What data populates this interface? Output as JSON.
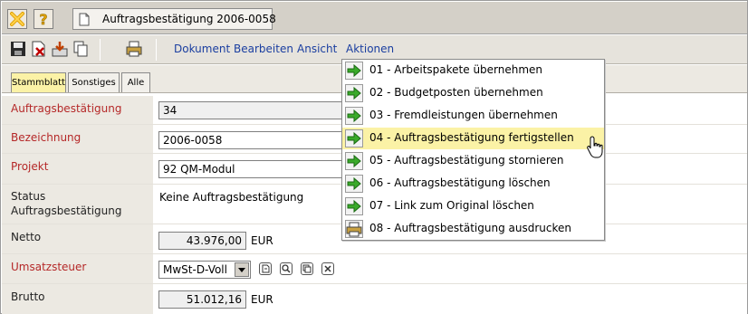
{
  "titlebar": {
    "title": "Auftragsbestätigung 2006-0058",
    "close_icon": "close-x-icon",
    "help_icon": "help-icon",
    "doc_icon": "document-icon"
  },
  "toolbar": {
    "icons": [
      "save-icon",
      "delete-icon",
      "export-icon",
      "copy-icon",
      "print-icon"
    ],
    "menu": {
      "dokument": "Dokument",
      "bearbeiten": "Bearbeiten",
      "ansicht": "Ansicht",
      "aktionen": "Aktionen"
    }
  },
  "tabs": [
    {
      "label": "Stammblatt",
      "active": true
    },
    {
      "label": "Sonstiges",
      "active": false
    },
    {
      "label": "Alle",
      "active": false
    }
  ],
  "form": {
    "auftragsbestaetigung": {
      "label": "Auftragsbestätigung",
      "value": "34"
    },
    "bezeichnung": {
      "label": "Bezeichnung",
      "value": "2006-0058"
    },
    "projekt": {
      "label": "Projekt",
      "value": "92 QM-Modul"
    },
    "status": {
      "label_line1": "Status",
      "label_line2": "Auftragsbestätigung",
      "value": "Keine Auftragsbestätigung"
    },
    "netto": {
      "label": "Netto",
      "value": "43.976,00",
      "unit": "EUR"
    },
    "umsatzsteuer": {
      "label": "Umsatzsteuer",
      "value": "MwSt-D-Voll",
      "action_icons": [
        "edit-icon",
        "search-icon",
        "copy-icon",
        "clear-icon"
      ]
    },
    "brutto": {
      "label": "Brutto",
      "value": "51.012,16",
      "unit": "EUR"
    }
  },
  "actions_menu": {
    "items": [
      {
        "label": "01 - Arbeitspakete übernehmen",
        "icon": "green-arrow-icon",
        "highlighted": false
      },
      {
        "label": "02 - Budgetposten übernehmen",
        "icon": "green-arrow-icon",
        "highlighted": false
      },
      {
        "label": "03 - Fremdleistungen übernehmen",
        "icon": "green-arrow-icon",
        "highlighted": false
      },
      {
        "label": "04 - Auftragsbestätigung fertigstellen",
        "icon": "green-arrow-icon",
        "highlighted": true
      },
      {
        "label": "05 - Auftragsbestätigung stornieren",
        "icon": "green-arrow-icon",
        "highlighted": false
      },
      {
        "label": "06 - Auftragsbestätigung löschen",
        "icon": "green-arrow-icon",
        "highlighted": false
      },
      {
        "label": "07 - Link zum Original löschen",
        "icon": "green-arrow-icon",
        "highlighted": false
      },
      {
        "label": "08 - Auftragsbestätigung ausdrucken",
        "icon": "printer-icon",
        "highlighted": false
      }
    ]
  },
  "colors": {
    "required_label": "#b52828",
    "menu_link": "#1a3ea0",
    "highlight": "#fbf2a6",
    "panel_bg": "#ece9e2"
  }
}
